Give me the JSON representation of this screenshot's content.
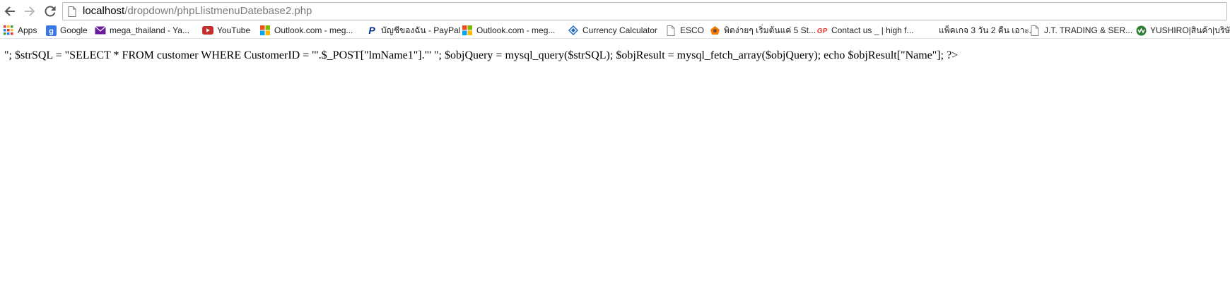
{
  "browser": {
    "url_host": "localhost",
    "url_path": "/dropdown/phpLlistmenuDatebase2.php",
    "icons": {
      "back": "arrow-left-icon",
      "forward": "arrow-right-icon",
      "reload": "reload-icon",
      "page": "page-icon"
    }
  },
  "bookmarks": [
    {
      "label": "Apps",
      "icon": "apps-grid-icon"
    },
    {
      "label": "Google",
      "icon": "google-icon"
    },
    {
      "label": "mega_thailand - Ya...",
      "icon": "mail-icon"
    },
    {
      "label": "YouTube",
      "icon": "youtube-icon"
    },
    {
      "label": "Outlook.com - meg...",
      "icon": "windows-icon"
    },
    {
      "label": "บัญชีของฉัน - PayPal",
      "icon": "paypal-icon"
    },
    {
      "label": "Outlook.com - meg...",
      "icon": "windows-icon"
    },
    {
      "label": "Currency Calculator",
      "icon": "diamond-icon"
    },
    {
      "label": "ESCO",
      "icon": "page-icon"
    },
    {
      "label": "พิตง่ายๆ เริ่มต้นแค่ 5 St...",
      "icon": "orange-logo-icon"
    },
    {
      "label": "Contact us _ | high f...",
      "icon": "red-logo-icon"
    },
    {
      "label": "แพ็คเกจ 3 วัน 2 คืน เอาะ...",
      "icon": "blank-icon"
    },
    {
      "label": "J.T. TRADING & SER...",
      "icon": "page-icon"
    },
    {
      "label": "YUSHIRO|สินค้า|บริษัท",
      "icon": "green-logo-icon"
    }
  ],
  "page": {
    "text": "\"; $strSQL = \"SELECT * FROM customer WHERE CustomerID = '\".$_POST[\"lmName1\"].\"' \"; $objQuery = mysql_query($strSQL); $objResult = mysql_fetch_array($objQuery); echo $objResult[\"Name\"]; ?>"
  },
  "colors": {
    "url_path": "#7a7a7a",
    "toolbar_border": "#bdbdbd"
  }
}
